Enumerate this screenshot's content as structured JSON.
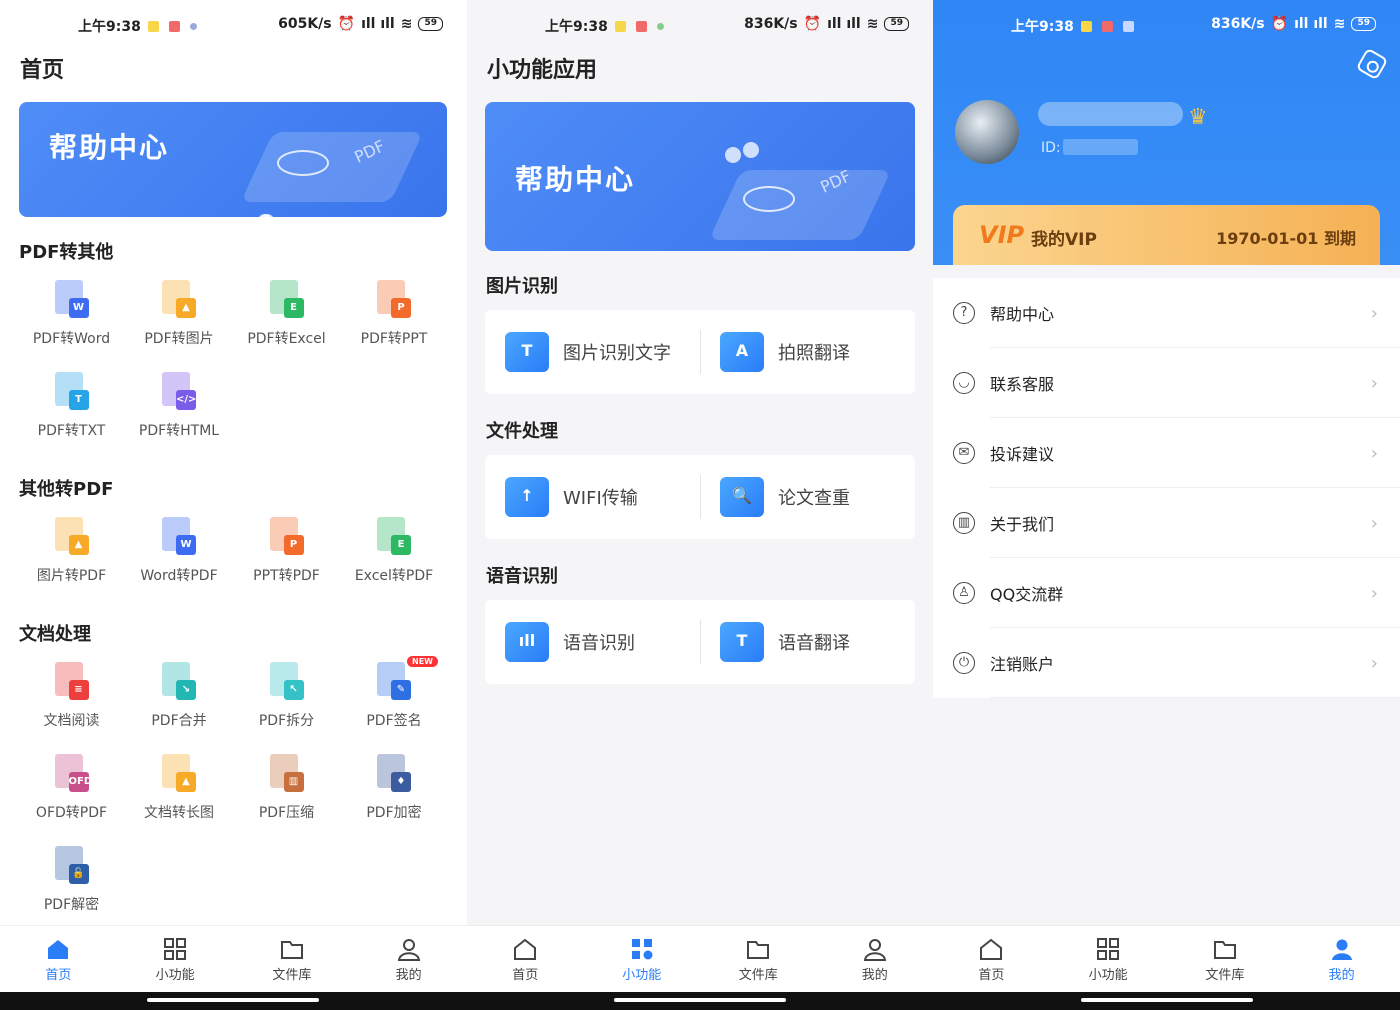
{
  "status": [
    {
      "time": "上午9:38",
      "speed": "605K/s",
      "battery": "59"
    },
    {
      "time": "上午9:38",
      "speed": "836K/s",
      "battery": "59"
    },
    {
      "time": "上午9:38",
      "speed": "836K/s",
      "battery": "59"
    }
  ],
  "home": {
    "title": "首页",
    "banner": "帮助中心",
    "banner_pdf": "PDF",
    "sections": [
      {
        "title": "PDF转其他",
        "items": [
          {
            "label": "PDF转Word",
            "badge": "W",
            "color": "#3d6cf2"
          },
          {
            "label": "PDF转图片",
            "badge": "▲",
            "color": "#f7a928"
          },
          {
            "label": "PDF转Excel",
            "badge": "E",
            "color": "#2db863"
          },
          {
            "label": "PDF转PPT",
            "badge": "P",
            "color": "#f26b2a"
          },
          {
            "label": "PDF转TXT",
            "badge": "T",
            "color": "#27a3e8"
          },
          {
            "label": "PDF转HTML",
            "badge": "</>",
            "color": "#7b5ce8"
          }
        ]
      },
      {
        "title": "其他转PDF",
        "items": [
          {
            "label": "图片转PDF",
            "badge": "▲",
            "color": "#f7a928"
          },
          {
            "label": "Word转PDF",
            "badge": "W",
            "color": "#3d6cf2"
          },
          {
            "label": "PPT转PDF",
            "badge": "P",
            "color": "#f26b2a"
          },
          {
            "label": "Excel转PDF",
            "badge": "E",
            "color": "#2db863"
          }
        ]
      },
      {
        "title": "文档处理",
        "items": [
          {
            "label": "文档阅读",
            "badge": "≡",
            "color": "#ee3f3f"
          },
          {
            "label": "PDF合并",
            "badge": "↘",
            "color": "#23b7b3"
          },
          {
            "label": "PDF拆分",
            "badge": "↖",
            "color": "#34c2c7"
          },
          {
            "label": "PDF签名",
            "badge": "✎",
            "color": "#2f6fe4",
            "new": "NEW"
          },
          {
            "label": "OFD转PDF",
            "badge": "OFD",
            "color": "#c94f8b"
          },
          {
            "label": "文档转长图",
            "badge": "▲",
            "color": "#f7a928"
          },
          {
            "label": "PDF压缩",
            "badge": "▥",
            "color": "#c7703e"
          },
          {
            "label": "PDF加密",
            "badge": "♦",
            "color": "#3b5c9e"
          },
          {
            "label": "PDF解密",
            "badge": "🔓",
            "color": "#2f5ea8"
          }
        ]
      }
    ]
  },
  "tools": {
    "title": "小功能应用",
    "banner": "帮助中心",
    "banner_pdf": "PDF",
    "sections": [
      {
        "title": "图片识别",
        "items": [
          {
            "label": "图片识别文字",
            "icon": "image-text-icon",
            "glyph": "T"
          },
          {
            "label": "拍照翻译",
            "icon": "camera-translate-icon",
            "glyph": "A"
          }
        ]
      },
      {
        "title": "文件处理",
        "items": [
          {
            "label": "WIFI传输",
            "icon": "wifi-transfer-icon",
            "glyph": "↑"
          },
          {
            "label": "论文查重",
            "icon": "paper-check-icon",
            "glyph": "🔍"
          }
        ]
      },
      {
        "title": "语音识别",
        "items": [
          {
            "label": "语音识别",
            "icon": "voice-recognize-icon",
            "glyph": "ıll"
          },
          {
            "label": "语音翻译",
            "icon": "voice-translate-icon",
            "glyph": "T"
          }
        ]
      }
    ]
  },
  "mine": {
    "id_label": "ID:",
    "vip_logo": "VIP",
    "vip_title": "我的VIP",
    "vip_date": "1970-01-01 到期",
    "menu": [
      {
        "label": "帮助中心",
        "icon": "help-icon",
        "glyph": "?"
      },
      {
        "label": "联系客服",
        "icon": "service-icon",
        "glyph": "◡"
      },
      {
        "label": "投诉建议",
        "icon": "feedback-icon",
        "glyph": "✉"
      },
      {
        "label": "关于我们",
        "icon": "about-icon",
        "glyph": "▥"
      },
      {
        "label": "QQ交流群",
        "icon": "qq-icon",
        "glyph": "♙"
      },
      {
        "label": "注销账户",
        "icon": "power-icon",
        "glyph": "⏻"
      }
    ]
  },
  "nav": {
    "tabs": [
      "首页",
      "小功能",
      "文件库",
      "我的"
    ]
  },
  "colors": {
    "accent": "#2a7cf7"
  }
}
